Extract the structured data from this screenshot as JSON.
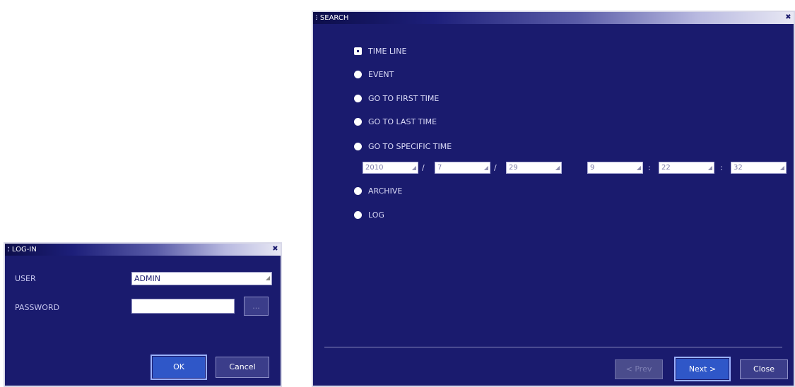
{
  "login": {
    "title": "LOG-IN",
    "user_label": "USER",
    "user_value": "ADMIN",
    "password_label": "PASSWORD",
    "password_value": "",
    "browse_label": "...",
    "ok_label": "OK",
    "cancel_label": "Cancel"
  },
  "search": {
    "title": "SEARCH",
    "options": [
      {
        "label": "TIME LINE",
        "selected": true
      },
      {
        "label": "EVENT",
        "selected": false
      },
      {
        "label": "GO TO FIRST TIME",
        "selected": false
      },
      {
        "label": "GO TO LAST TIME",
        "selected": false
      },
      {
        "label": "GO TO SPECIFIC TIME",
        "selected": false
      },
      {
        "label": "ARCHIVE",
        "selected": false
      },
      {
        "label": "LOG",
        "selected": false
      }
    ],
    "specific_time": {
      "year": "2010",
      "month": "7",
      "day": "29",
      "hour": "9",
      "minute": "22",
      "second": "32",
      "date_sep": "/",
      "time_sep": ":"
    },
    "prev_label": "< Prev",
    "next_label": "Next >",
    "close_label": "Close"
  },
  "colors": {
    "window_bg": "#1a1b6e",
    "accent_button": "#2f57c8"
  }
}
